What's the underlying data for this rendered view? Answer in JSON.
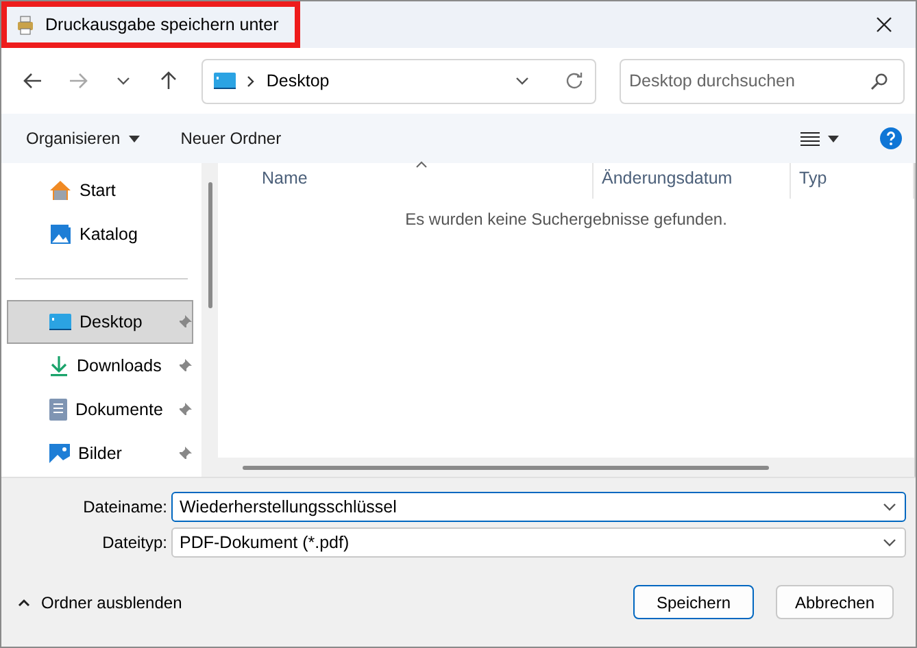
{
  "window": {
    "title": "Druckausgabe speichern unter",
    "title_highlighted": true
  },
  "navigation": {
    "back_enabled": true,
    "forward_enabled": false,
    "location": "Desktop",
    "search": {
      "placeholder": "Desktop durchsuchen"
    }
  },
  "toolbar": {
    "organize": "Organisieren",
    "new_folder": "Neuer Ordner"
  },
  "sidebar": {
    "quick": [
      {
        "label": "Start",
        "kind": "home",
        "pinned": false,
        "selected": false
      },
      {
        "label": "Katalog",
        "kind": "gallery",
        "pinned": false,
        "selected": false
      }
    ],
    "places": [
      {
        "label": "Desktop",
        "kind": "desktop",
        "pinned": true,
        "selected": true
      },
      {
        "label": "Downloads",
        "kind": "download",
        "pinned": true,
        "selected": false
      },
      {
        "label": "Dokumente",
        "kind": "document",
        "pinned": true,
        "selected": false
      },
      {
        "label": "Bilder",
        "kind": "pictures",
        "pinned": true,
        "selected": false
      }
    ]
  },
  "columns": [
    {
      "label": "Name",
      "sorted": true
    },
    {
      "label": "Änderungsdatum",
      "sorted": false
    },
    {
      "label": "Typ",
      "sorted": false
    }
  ],
  "empty_message": "Es wurden keine Suchergebnisse gefunden.",
  "form": {
    "fields": [
      {
        "label": "Dateiname:",
        "value": "Wiederherstellungsschlüssel",
        "focused": true
      },
      {
        "label": "Dateityp:",
        "value": "PDF-Dokument (*.pdf)",
        "focused": false
      }
    ]
  },
  "footer": {
    "toggle": "Ordner ausblenden",
    "buttons": [
      {
        "label": "Speichern",
        "default": true
      },
      {
        "label": "Abbrechen",
        "default": false
      }
    ]
  }
}
